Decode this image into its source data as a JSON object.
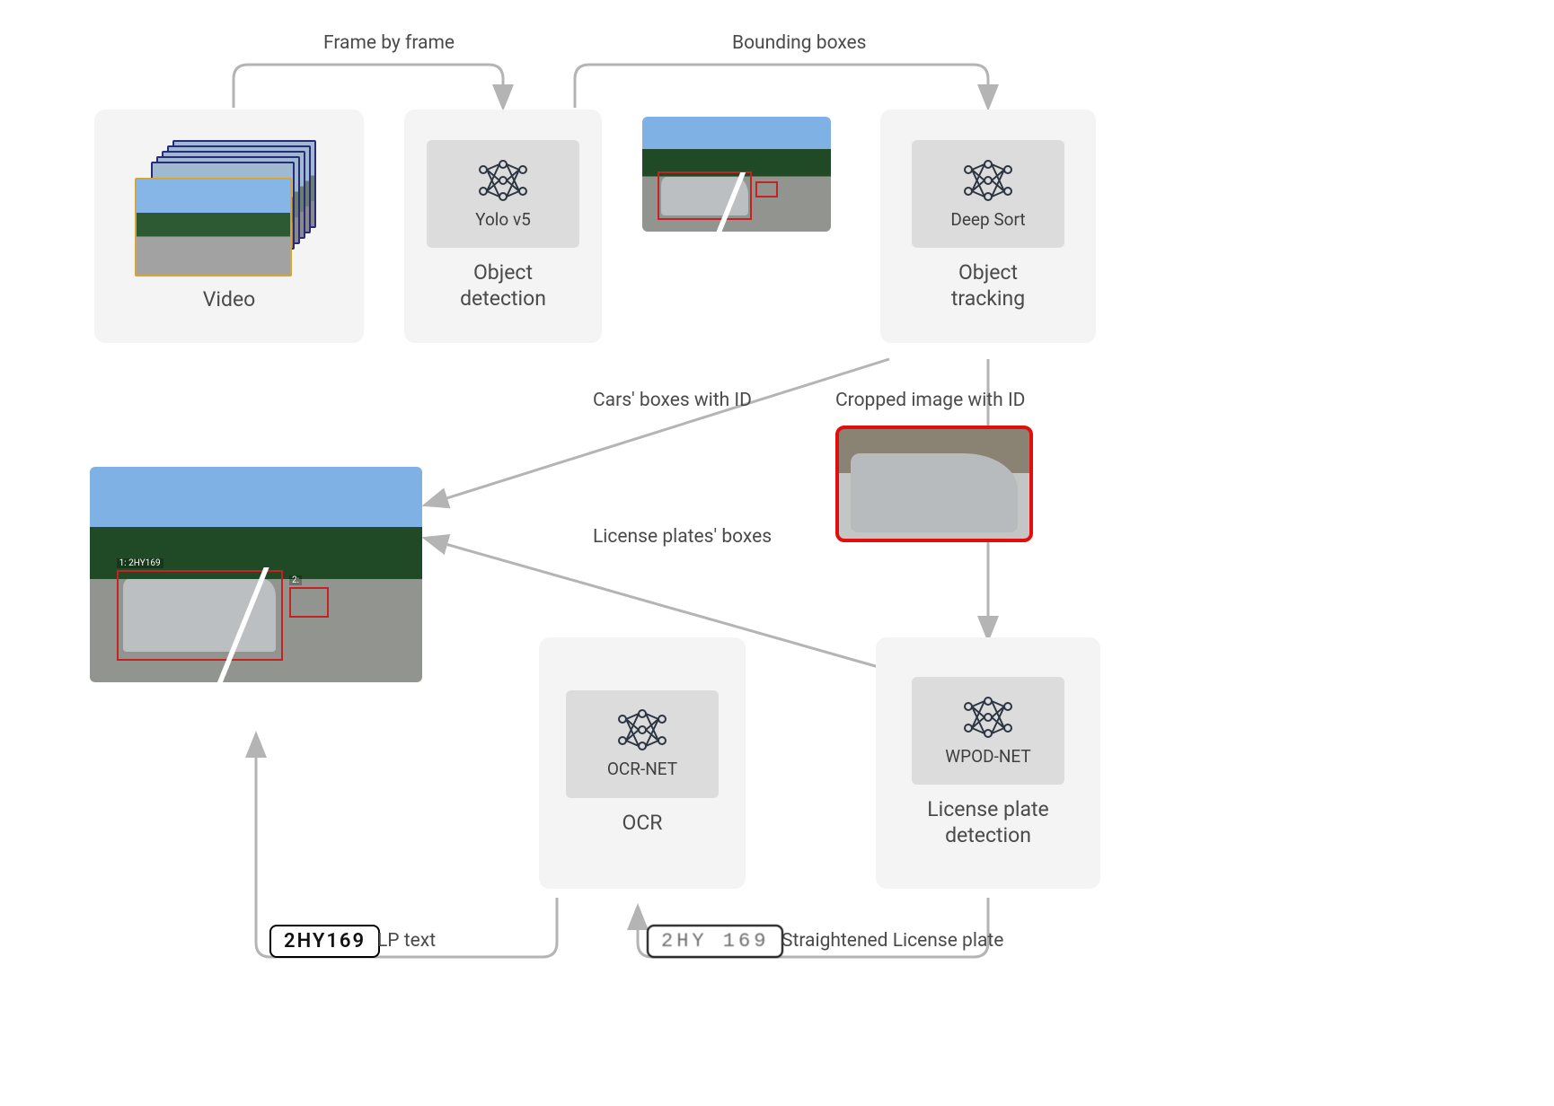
{
  "stages": {
    "video": {
      "label": "Video"
    },
    "object_detection": {
      "label": "Object\ndetection",
      "model": "Yolo v5"
    },
    "object_tracking": {
      "label": "Object\ntracking",
      "model": "Deep Sort"
    },
    "lp_detection": {
      "label": "License plate\ndetection",
      "model": "WPOD-NET"
    },
    "ocr": {
      "label": "OCR",
      "model": "OCR-NET"
    }
  },
  "edges": {
    "frame_by_frame": "Frame by  frame",
    "bounding_boxes": "Bounding boxes",
    "cars_boxes_id": "Cars' boxes with ID",
    "cropped_image_id": "Cropped image with ID",
    "license_plates_boxes": "License plates' boxes",
    "straightened_lp": "Straightened License plate",
    "lp_text": "LP text"
  },
  "result": {
    "plate_text": "2HY169",
    "plate_image_text": "2HY 169",
    "detected_id_1": "1: 2HY169",
    "detected_id_2": "2:"
  }
}
